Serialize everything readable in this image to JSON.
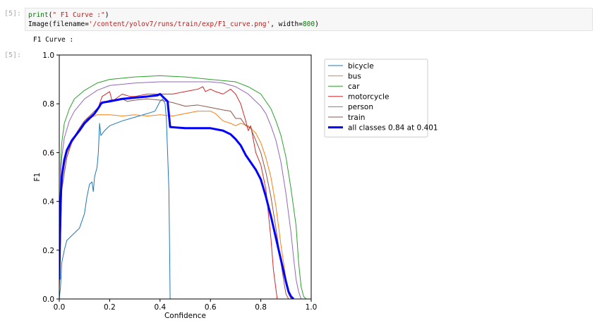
{
  "cells": {
    "in_prompt": "[5]:",
    "out_prompt": "[5]:",
    "code_line1_fn": "print",
    "code_line1_open": "(",
    "code_line1_str": "\" F1 Curve :\"",
    "code_line1_close": ")",
    "code_line2_fn": "Image(filename=",
    "code_line2_str": "'/content/yolov7/runs/train/exp/F1_curve.png'",
    "code_line2_mid": ", width=",
    "code_line2_num": "800",
    "code_line2_close": ")",
    "stdout": "F1 Curve :"
  },
  "chart_data": {
    "type": "line",
    "xlabel": "Confidence",
    "ylabel": "F1",
    "xlim": [
      0,
      1
    ],
    "ylim": [
      0,
      1
    ],
    "xticks": [
      "0.0",
      "0.2",
      "0.4",
      "0.6",
      "0.8",
      "1.0"
    ],
    "yticks": [
      "0.0",
      "0.2",
      "0.4",
      "0.6",
      "0.8",
      "1.0"
    ],
    "grid": false,
    "legend_position": "outside-right-top",
    "series": [
      {
        "name": "bicycle",
        "color": "#1f77b4",
        "width": 1,
        "points": [
          [
            0,
            0
          ],
          [
            0.005,
            0.05
          ],
          [
            0.01,
            0.15
          ],
          [
            0.02,
            0.2
          ],
          [
            0.03,
            0.24
          ],
          [
            0.05,
            0.26
          ],
          [
            0.08,
            0.29
          ],
          [
            0.1,
            0.35
          ],
          [
            0.11,
            0.42
          ],
          [
            0.12,
            0.47
          ],
          [
            0.13,
            0.48
          ],
          [
            0.135,
            0.44
          ],
          [
            0.14,
            0.5
          ],
          [
            0.15,
            0.54
          ],
          [
            0.155,
            0.6
          ],
          [
            0.16,
            0.72
          ],
          [
            0.165,
            0.67
          ],
          [
            0.18,
            0.69
          ],
          [
            0.2,
            0.71
          ],
          [
            0.25,
            0.73
          ],
          [
            0.3,
            0.745
          ],
          [
            0.35,
            0.76
          ],
          [
            0.38,
            0.77
          ],
          [
            0.39,
            0.79
          ],
          [
            0.4,
            0.81
          ],
          [
            0.41,
            0.82
          ],
          [
            0.42,
            0.8
          ],
          [
            0.425,
            0.74
          ],
          [
            0.43,
            0.6
          ],
          [
            0.435,
            0.45
          ],
          [
            0.438,
            0.2
          ],
          [
            0.44,
            0
          ]
        ]
      },
      {
        "name": "bus",
        "color": "#ff7f0e",
        "width": 1,
        "points": [
          [
            0,
            0.05
          ],
          [
            0.01,
            0.45
          ],
          [
            0.03,
            0.58
          ],
          [
            0.05,
            0.64
          ],
          [
            0.08,
            0.69
          ],
          [
            0.1,
            0.72
          ],
          [
            0.12,
            0.74
          ],
          [
            0.15,
            0.755
          ],
          [
            0.2,
            0.755
          ],
          [
            0.25,
            0.75
          ],
          [
            0.3,
            0.755
          ],
          [
            0.35,
            0.75
          ],
          [
            0.4,
            0.755
          ],
          [
            0.45,
            0.75
          ],
          [
            0.5,
            0.76
          ],
          [
            0.55,
            0.77
          ],
          [
            0.6,
            0.77
          ],
          [
            0.62,
            0.76
          ],
          [
            0.65,
            0.73
          ],
          [
            0.68,
            0.72
          ],
          [
            0.7,
            0.71
          ],
          [
            0.72,
            0.72
          ],
          [
            0.75,
            0.71
          ],
          [
            0.78,
            0.68
          ],
          [
            0.8,
            0.64
          ],
          [
            0.82,
            0.58
          ],
          [
            0.84,
            0.5
          ],
          [
            0.86,
            0.38
          ],
          [
            0.88,
            0.22
          ],
          [
            0.9,
            0.08
          ],
          [
            0.91,
            0.02
          ],
          [
            0.92,
            0
          ]
        ]
      },
      {
        "name": "car",
        "color": "#2ca02c",
        "width": 1,
        "points": [
          [
            0,
            0.1
          ],
          [
            0.005,
            0.55
          ],
          [
            0.01,
            0.64
          ],
          [
            0.02,
            0.72
          ],
          [
            0.04,
            0.78
          ],
          [
            0.06,
            0.82
          ],
          [
            0.1,
            0.855
          ],
          [
            0.15,
            0.885
          ],
          [
            0.2,
            0.9
          ],
          [
            0.3,
            0.91
          ],
          [
            0.4,
            0.915
          ],
          [
            0.5,
            0.91
          ],
          [
            0.6,
            0.9
          ],
          [
            0.7,
            0.89
          ],
          [
            0.75,
            0.87
          ],
          [
            0.8,
            0.84
          ],
          [
            0.84,
            0.78
          ],
          [
            0.86,
            0.73
          ],
          [
            0.88,
            0.67
          ],
          [
            0.9,
            0.58
          ],
          [
            0.92,
            0.45
          ],
          [
            0.94,
            0.3
          ],
          [
            0.95,
            0.15
          ],
          [
            0.96,
            0.05
          ],
          [
            0.97,
            0.01
          ],
          [
            0.98,
            0
          ]
        ]
      },
      {
        "name": "motorcycle",
        "color": "#d62728",
        "width": 1,
        "points": [
          [
            0,
            0.06
          ],
          [
            0.01,
            0.5
          ],
          [
            0.03,
            0.6
          ],
          [
            0.05,
            0.65
          ],
          [
            0.08,
            0.7
          ],
          [
            0.1,
            0.73
          ],
          [
            0.12,
            0.745
          ],
          [
            0.15,
            0.77
          ],
          [
            0.16,
            0.8
          ],
          [
            0.17,
            0.83
          ],
          [
            0.2,
            0.85
          ],
          [
            0.21,
            0.81
          ],
          [
            0.25,
            0.84
          ],
          [
            0.28,
            0.83
          ],
          [
            0.3,
            0.83
          ],
          [
            0.35,
            0.84
          ],
          [
            0.4,
            0.84
          ],
          [
            0.42,
            0.84
          ],
          [
            0.45,
            0.84
          ],
          [
            0.5,
            0.85
          ],
          [
            0.55,
            0.86
          ],
          [
            0.57,
            0.87
          ],
          [
            0.58,
            0.85
          ],
          [
            0.6,
            0.86
          ],
          [
            0.62,
            0.85
          ],
          [
            0.65,
            0.84
          ],
          [
            0.68,
            0.86
          ],
          [
            0.7,
            0.84
          ],
          [
            0.72,
            0.8
          ],
          [
            0.74,
            0.73
          ],
          [
            0.75,
            0.69
          ],
          [
            0.76,
            0.71
          ],
          [
            0.78,
            0.6
          ],
          [
            0.8,
            0.55
          ],
          [
            0.82,
            0.45
          ],
          [
            0.83,
            0.35
          ],
          [
            0.84,
            0.25
          ],
          [
            0.85,
            0.12
          ],
          [
            0.86,
            0.04
          ],
          [
            0.865,
            0
          ]
        ]
      },
      {
        "name": "person",
        "color": "#9467bd",
        "width": 1,
        "points": [
          [
            0,
            0.2
          ],
          [
            0.005,
            0.5
          ],
          [
            0.01,
            0.58
          ],
          [
            0.02,
            0.66
          ],
          [
            0.04,
            0.73
          ],
          [
            0.06,
            0.77
          ],
          [
            0.1,
            0.82
          ],
          [
            0.15,
            0.855
          ],
          [
            0.2,
            0.875
          ],
          [
            0.3,
            0.885
          ],
          [
            0.4,
            0.89
          ],
          [
            0.5,
            0.89
          ],
          [
            0.6,
            0.89
          ],
          [
            0.65,
            0.885
          ],
          [
            0.7,
            0.87
          ],
          [
            0.75,
            0.84
          ],
          [
            0.8,
            0.79
          ],
          [
            0.82,
            0.76
          ],
          [
            0.84,
            0.71
          ],
          [
            0.86,
            0.65
          ],
          [
            0.88,
            0.56
          ],
          [
            0.9,
            0.43
          ],
          [
            0.92,
            0.27
          ],
          [
            0.93,
            0.17
          ],
          [
            0.94,
            0.08
          ],
          [
            0.95,
            0.03
          ],
          [
            0.96,
            0
          ]
        ]
      },
      {
        "name": "train",
        "color": "#8c564b",
        "width": 1,
        "points": [
          [
            0,
            0.04
          ],
          [
            0.01,
            0.45
          ],
          [
            0.03,
            0.58
          ],
          [
            0.05,
            0.65
          ],
          [
            0.08,
            0.7
          ],
          [
            0.1,
            0.73
          ],
          [
            0.12,
            0.75
          ],
          [
            0.15,
            0.78
          ],
          [
            0.17,
            0.8
          ],
          [
            0.2,
            0.815
          ],
          [
            0.25,
            0.82
          ],
          [
            0.27,
            0.81
          ],
          [
            0.3,
            0.815
          ],
          [
            0.35,
            0.82
          ],
          [
            0.4,
            0.815
          ],
          [
            0.45,
            0.805
          ],
          [
            0.5,
            0.79
          ],
          [
            0.55,
            0.795
          ],
          [
            0.6,
            0.785
          ],
          [
            0.65,
            0.775
          ],
          [
            0.68,
            0.77
          ],
          [
            0.7,
            0.74
          ],
          [
            0.72,
            0.74
          ],
          [
            0.74,
            0.71
          ],
          [
            0.76,
            0.7
          ],
          [
            0.78,
            0.65
          ],
          [
            0.8,
            0.6
          ],
          [
            0.82,
            0.52
          ],
          [
            0.84,
            0.42
          ],
          [
            0.86,
            0.29
          ],
          [
            0.88,
            0.15
          ],
          [
            0.89,
            0.08
          ],
          [
            0.9,
            0.02
          ],
          [
            0.91,
            0
          ]
        ]
      },
      {
        "name": "all classes 0.84 at 0.401",
        "color": "#0000ff",
        "width": 3,
        "points": [
          [
            0,
            0.08
          ],
          [
            0.005,
            0.4
          ],
          [
            0.01,
            0.5
          ],
          [
            0.02,
            0.57
          ],
          [
            0.03,
            0.61
          ],
          [
            0.05,
            0.65
          ],
          [
            0.08,
            0.69
          ],
          [
            0.1,
            0.72
          ],
          [
            0.12,
            0.74
          ],
          [
            0.14,
            0.76
          ],
          [
            0.15,
            0.775
          ],
          [
            0.16,
            0.79
          ],
          [
            0.165,
            0.8
          ],
          [
            0.17,
            0.805
          ],
          [
            0.2,
            0.81
          ],
          [
            0.25,
            0.82
          ],
          [
            0.3,
            0.825
          ],
          [
            0.35,
            0.83
          ],
          [
            0.39,
            0.835
          ],
          [
            0.4,
            0.84
          ],
          [
            0.41,
            0.83
          ],
          [
            0.42,
            0.82
          ],
          [
            0.43,
            0.81
          ],
          [
            0.44,
            0.705
          ],
          [
            0.5,
            0.7
          ],
          [
            0.55,
            0.7
          ],
          [
            0.6,
            0.7
          ],
          [
            0.65,
            0.69
          ],
          [
            0.68,
            0.675
          ],
          [
            0.7,
            0.655
          ],
          [
            0.72,
            0.63
          ],
          [
            0.74,
            0.59
          ],
          [
            0.76,
            0.56
          ],
          [
            0.78,
            0.53
          ],
          [
            0.8,
            0.49
          ],
          [
            0.82,
            0.42
          ],
          [
            0.84,
            0.34
          ],
          [
            0.86,
            0.25
          ],
          [
            0.88,
            0.16
          ],
          [
            0.9,
            0.07
          ],
          [
            0.91,
            0.03
          ],
          [
            0.92,
            0.01
          ],
          [
            0.93,
            0
          ]
        ]
      }
    ]
  }
}
